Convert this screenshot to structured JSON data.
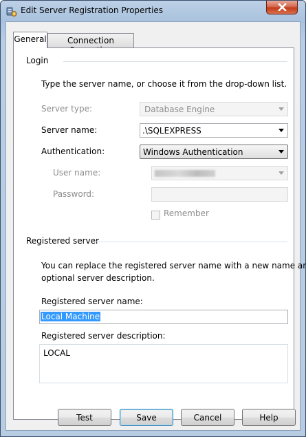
{
  "window": {
    "title": "Edit Server Registration Properties"
  },
  "tabs": [
    {
      "label": "General",
      "selected": true
    },
    {
      "label": "Connection Properties",
      "selected": false
    }
  ],
  "login": {
    "group_title": "Login",
    "instructions": "Type the server name, or choose it from the drop-down list.",
    "server_type": {
      "label": "Server type:",
      "value": "Database Engine",
      "enabled": false
    },
    "server_name": {
      "label": "Server name:",
      "value": ".\\SQLEXPRESS"
    },
    "authentication": {
      "label": "Authentication:",
      "value": "Windows Authentication"
    },
    "user_name": {
      "label": "User name:",
      "enabled": false
    },
    "password": {
      "label": "Password:",
      "enabled": false
    },
    "remember": {
      "label": "Remember",
      "checked": false,
      "enabled": false
    }
  },
  "registered": {
    "group_title": "Registered server",
    "instructions_line1": "You can replace the registered server name with a new name and",
    "instructions_line2": "optional server description.",
    "name_label": "Registered server name:",
    "name_value": "Local Machine",
    "description_label": "Registered server description:",
    "description_value": "LOCAL"
  },
  "buttons": {
    "test": "Test",
    "save": "Save",
    "cancel": "Cancel",
    "help": "Help"
  },
  "colors": {
    "selection": "#3399ff",
    "disabled_text": "#8d8d8d",
    "close_button": "#c23b1c"
  }
}
